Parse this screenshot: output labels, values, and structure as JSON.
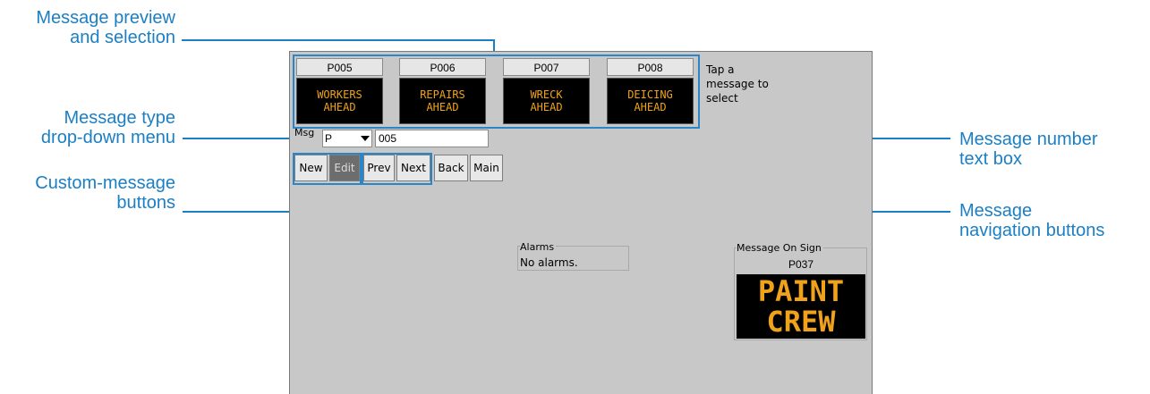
{
  "annotations": {
    "preview": [
      "Message preview",
      "and selection"
    ],
    "type_menu": [
      "Message type",
      "drop-down menu"
    ],
    "custom_buttons": [
      "Custom-message",
      "buttons"
    ],
    "number_box": [
      "Message number",
      "text box"
    ],
    "nav_buttons": [
      "Message",
      "navigation buttons"
    ]
  },
  "colors": {
    "annotation": "#1b7fc4",
    "sign_text": "#f0a21a",
    "panel": "#c8c8c8"
  },
  "messages": [
    {
      "id": "P005",
      "line1": "WORKERS",
      "line2": "AHEAD"
    },
    {
      "id": "P006",
      "line1": "REPAIRS",
      "line2": "AHEAD"
    },
    {
      "id": "P007",
      "line1": "WRECK",
      "line2": "AHEAD"
    },
    {
      "id": "P008",
      "line1": "DEICING",
      "line2": "AHEAD"
    }
  ],
  "hint": "Tap a message to select",
  "msg_label": "Msg",
  "type_select": {
    "value": "P",
    "icon": "chevron-down-icon"
  },
  "number_input": {
    "value": "005"
  },
  "buttons": {
    "new": "New",
    "edit": "Edit",
    "prev": "Prev",
    "next": "Next",
    "back": "Back",
    "main": "Main"
  },
  "alarms": {
    "title": "Alarms",
    "text": "No alarms."
  },
  "sign": {
    "title": "Message On Sign",
    "id": "P037",
    "line1": "PAINT",
    "line2": "CREW"
  }
}
